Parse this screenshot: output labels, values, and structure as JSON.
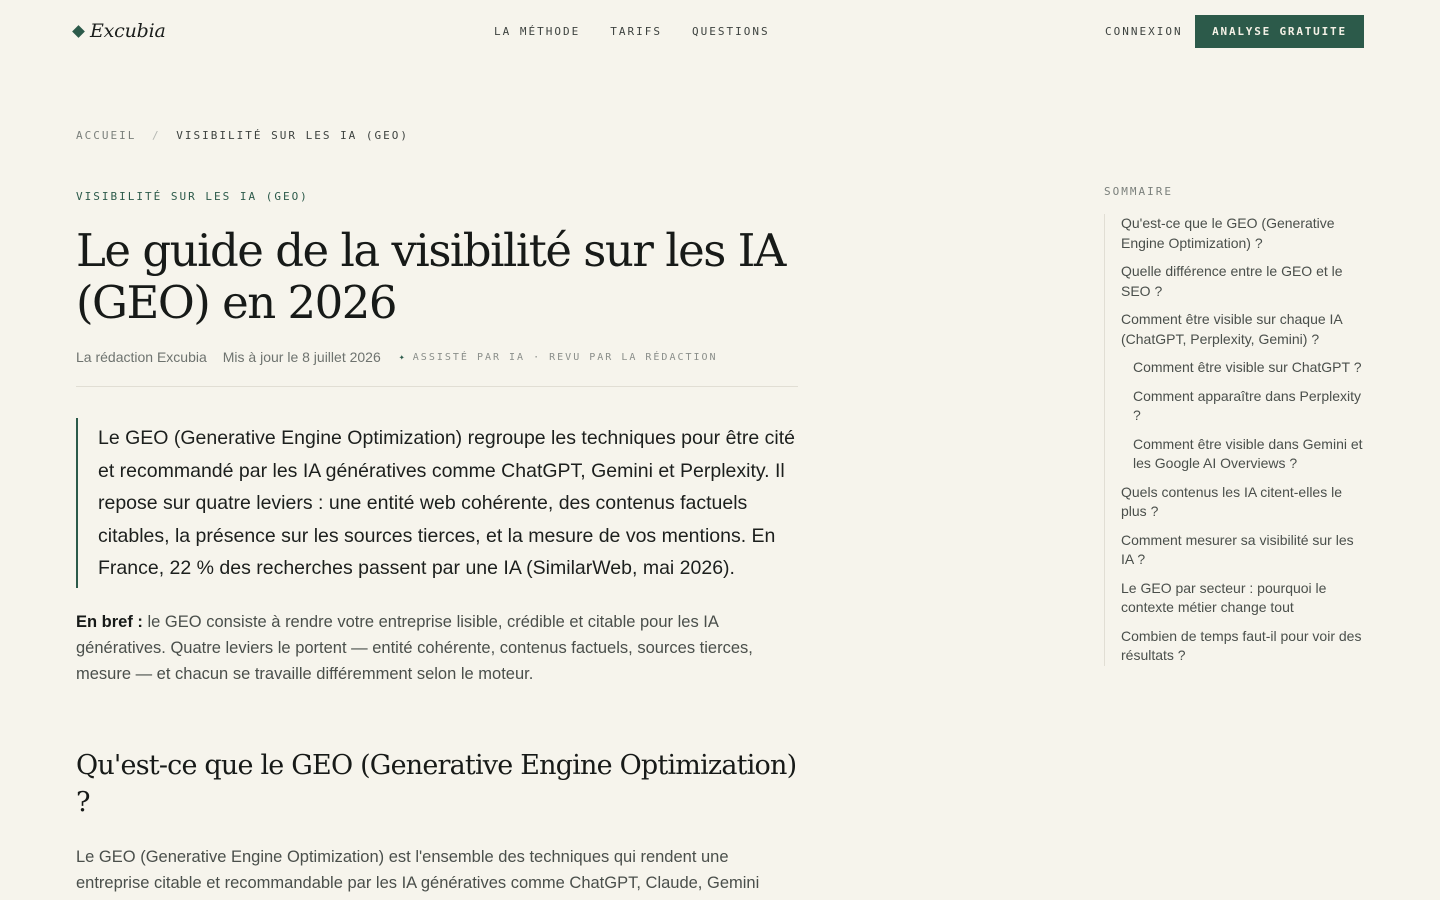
{
  "header": {
    "logo_text": "Excubia",
    "nav": [
      "LA MÉTHODE",
      "TARIFS",
      "QUESTIONS"
    ],
    "login_label": "CONNEXION",
    "cta_label": "ANALYSE GRATUITE"
  },
  "breadcrumb": {
    "home": "ACCUEIL",
    "separator": "/",
    "current": "VISIBILITÉ SUR LES IA (GEO)"
  },
  "article": {
    "eyebrow": "VISIBILITÉ SUR LES IA (GEO)",
    "title": "Le guide de la visibilité sur les IA (GEO) en 2026",
    "author": "La rédaction Excubia",
    "updated": "Mis à jour le 8 juillet 2026",
    "ai_star": "✦",
    "ai_tag": "ASSISTÉ PAR IA · REVU PAR LA RÉDACTION",
    "lead": "Le GEO (Generative Engine Optimization) regroupe les techniques pour être cité et recommandé par les IA génératives comme ChatGPT, Gemini et Perplexity. Il repose sur quatre leviers : une entité web cohérente, des contenus factuels citables, la présence sur les sources tierces, et la mesure de vos mentions. En France, 22 % des recherches passent par une IA (SimilarWeb, mai 2026).",
    "brief_label": "En bref :",
    "brief_text": " le GEO consiste à rendre votre entreprise lisible, crédible et citable pour les IA génératives. Quatre leviers le portent — entité cohérente, contenus factuels, sources tierces, mesure — et chacun se travaille différemment selon le moteur.",
    "section_title": "Qu'est-ce que le GEO (Generative Engine Optimization) ?",
    "section_para": "Le GEO (Generative Engine Optimization) est l'ensemble des techniques qui rendent une entreprise citable et recommandable par les IA génératives comme ChatGPT, Claude, Gemini"
  },
  "toc": {
    "title": "SOMMAIRE",
    "items": [
      {
        "label": "Qu'est-ce que le GEO (Generative Engine Optimization) ?",
        "sub": false
      },
      {
        "label": "Quelle différence entre le GEO et le SEO ?",
        "sub": false
      },
      {
        "label": "Comment être visible sur chaque IA (ChatGPT, Perplexity, Gemini) ?",
        "sub": false
      },
      {
        "label": "Comment être visible sur ChatGPT ?",
        "sub": true
      },
      {
        "label": "Comment apparaître dans Perplexity ?",
        "sub": true
      },
      {
        "label": "Comment être visible dans Gemini et les Google AI Overviews ?",
        "sub": true
      },
      {
        "label": "Quels contenus les IA citent-elles le plus ?",
        "sub": false
      },
      {
        "label": "Comment mesurer sa visibilité sur les IA ?",
        "sub": false
      },
      {
        "label": "Le GEO par secteur : pourquoi le contexte métier change tout",
        "sub": false
      },
      {
        "label": "Combien de temps faut-il pour voir des résultats ?",
        "sub": false
      }
    ]
  }
}
